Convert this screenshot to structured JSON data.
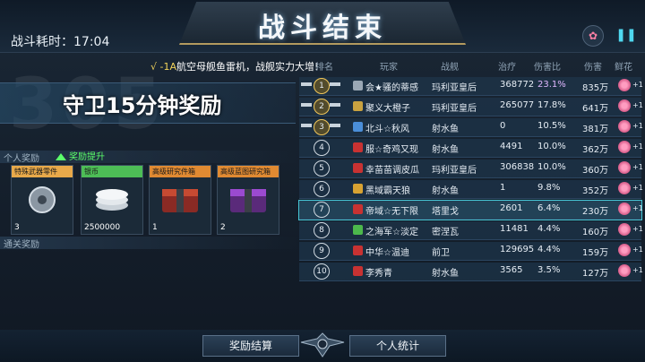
{
  "header": {
    "title": "战斗结束",
    "battle_time_label": "战斗耗时：",
    "battle_time_value": "17:04"
  },
  "notice": {
    "prefix": "√ -1A",
    "text": "航空母舰鱼雷机，战舰实力大增!"
  },
  "reward": {
    "bg_number": "305",
    "title": "守卫15分钟奖励",
    "personal_label": "个人奖励",
    "boost_label": "奖励提升",
    "clear_label": "通关奖励",
    "items": [
      {
        "name": "特殊武器零件",
        "qty": "3",
        "header_color": "#e8a94a"
      },
      {
        "name": "银币",
        "qty": "2500000",
        "header_color": "#4dbd56"
      },
      {
        "name": "高级研究件箱",
        "qty": "1",
        "header_color": "#e08a32"
      },
      {
        "name": "高级蓝图研究箱",
        "qty": "2",
        "header_color": "#e08a32"
      }
    ]
  },
  "table": {
    "headers": {
      "name": "排名",
      "player": "玩家",
      "ship": "战舰",
      "heal": "治疗",
      "pct": "伤害比",
      "dmg": "伤害",
      "flower": "鲜花"
    },
    "rows": [
      {
        "rank": "1",
        "name": "会★骚的蒂感",
        "ship": "玛利亚皇后",
        "heal": "368772",
        "pct": "23.1%",
        "dmg": "835万",
        "plus": "+1",
        "flag": "#9aa7b4"
      },
      {
        "rank": "2",
        "name": "聚义大橙子",
        "ship": "玛利亚皇后",
        "heal": "265077",
        "pct": "17.8%",
        "dmg": "641万",
        "plus": "+1",
        "flag": "#c9a240"
      },
      {
        "rank": "3",
        "name": "北斗☆秋风",
        "ship": "射水鱼",
        "heal": "0",
        "pct": "10.5%",
        "dmg": "381万",
        "plus": "+1",
        "flag": "#4a8ed8"
      },
      {
        "rank": "4",
        "name": "服☆奇鸡又现",
        "ship": "射水鱼",
        "heal": "4491",
        "pct": "10.0%",
        "dmg": "362万",
        "plus": "+1",
        "flag": "#c83232"
      },
      {
        "rank": "5",
        "name": "幸苗苗调皮瓜",
        "ship": "玛利亚皇后",
        "heal": "306838",
        "pct": "10.0%",
        "dmg": "360万",
        "plus": "+1",
        "flag": "#c83232"
      },
      {
        "rank": "6",
        "name": "黑域霸天狼",
        "ship": "射水鱼",
        "heal": "1",
        "pct": "9.8%",
        "dmg": "352万",
        "plus": "+1",
        "flag": "#d8a232"
      },
      {
        "rank": "7",
        "name": "帝域☆无下限",
        "ship": "塔里戈",
        "heal": "2601",
        "pct": "6.4%",
        "dmg": "230万",
        "plus": "+1",
        "flag": "#c83232"
      },
      {
        "rank": "8",
        "name": "之海军☆淡定",
        "ship": "密涅瓦",
        "heal": "11481",
        "pct": "4.4%",
        "dmg": "160万",
        "plus": "+1",
        "flag": "#4cb84c"
      },
      {
        "rank": "9",
        "name": "中华☆温迪",
        "ship": "前卫",
        "heal": "129695",
        "pct": "4.4%",
        "dmg": "159万",
        "plus": "+1",
        "flag": "#c83232"
      },
      {
        "rank": "10",
        "name": "李秀青",
        "ship": "射水鱼",
        "heal": "3565",
        "pct": "3.5%",
        "dmg": "127万",
        "plus": "+1",
        "flag": "#c83232"
      }
    ]
  },
  "footer": {
    "settle_label": "奖励结算",
    "stats_label": "个人统计"
  },
  "colors": {
    "accent": "#47c7d6",
    "gold": "#f0c65a",
    "pct_top": "#e0b7ff"
  }
}
